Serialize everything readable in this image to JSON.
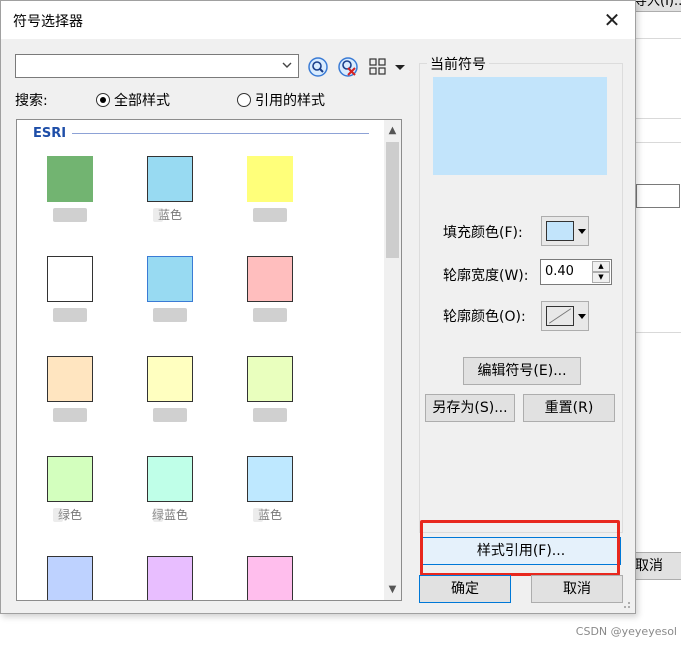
{
  "background": {
    "top_button_label": "导入(I)...",
    "cancel_label": "取消",
    "watermark": "CSDN @yeyeyesol"
  },
  "dialog": {
    "title": "符号选择器",
    "close_glyph": "✕"
  },
  "toolbar": {
    "style_combo_value": "",
    "search_label": "搜索:",
    "radio_all_label": "全部样式",
    "radio_ref_label": "引用的样式",
    "radio_selected": "all",
    "icons": [
      "search-icon",
      "clear-search-icon",
      "view-options-icon",
      "dropdown-arrow-icon"
    ]
  },
  "symbol_list": {
    "group_name": "ESRI",
    "items": [
      {
        "color": "#72b471",
        "label": ""
      },
      {
        "color": "#98daf2",
        "label": "蓝色"
      },
      {
        "color": "#ffff7a",
        "label": ""
      },
      {
        "color": "#ffffff",
        "label": ""
      },
      {
        "color": "#98daf2",
        "label": ""
      },
      {
        "color": "#ffbebe",
        "label": ""
      },
      {
        "color": "#ffe5c0",
        "label": ""
      },
      {
        "color": "#ffffc0",
        "label": ""
      },
      {
        "color": "#e9ffbe",
        "label": ""
      },
      {
        "color": "#d3ffbe",
        "label": "绿色"
      },
      {
        "color": "#bfffe8",
        "label": "绿蓝色"
      },
      {
        "color": "#bee8ff",
        "label": "蓝色"
      },
      {
        "color": "#bed2ff",
        "label": ""
      },
      {
        "color": "#e8beff",
        "label": ""
      },
      {
        "color": "#ffbeed",
        "label": ""
      }
    ]
  },
  "current_symbol": {
    "label": "当前符号",
    "preview_color": "#c2e4fb",
    "fill_color_label": "填充颜色(F):",
    "fill_color_value": "#c2e4fb",
    "outline_width_label": "轮廓宽度(W):",
    "outline_width_value": "0.40",
    "outline_color_label": "轮廓颜色(O):",
    "edit_symbol_label": "编辑符号(E)...",
    "save_as_label": "另存为(S)...",
    "reset_label": "重置(R)"
  },
  "footer": {
    "style_refs_label": "样式引用(F)...",
    "ok_label": "确定",
    "cancel_label": "取消"
  },
  "colors": {
    "highlight": "#e8281e",
    "accent": "#0078d7",
    "group_header": "#1e4ea8"
  }
}
